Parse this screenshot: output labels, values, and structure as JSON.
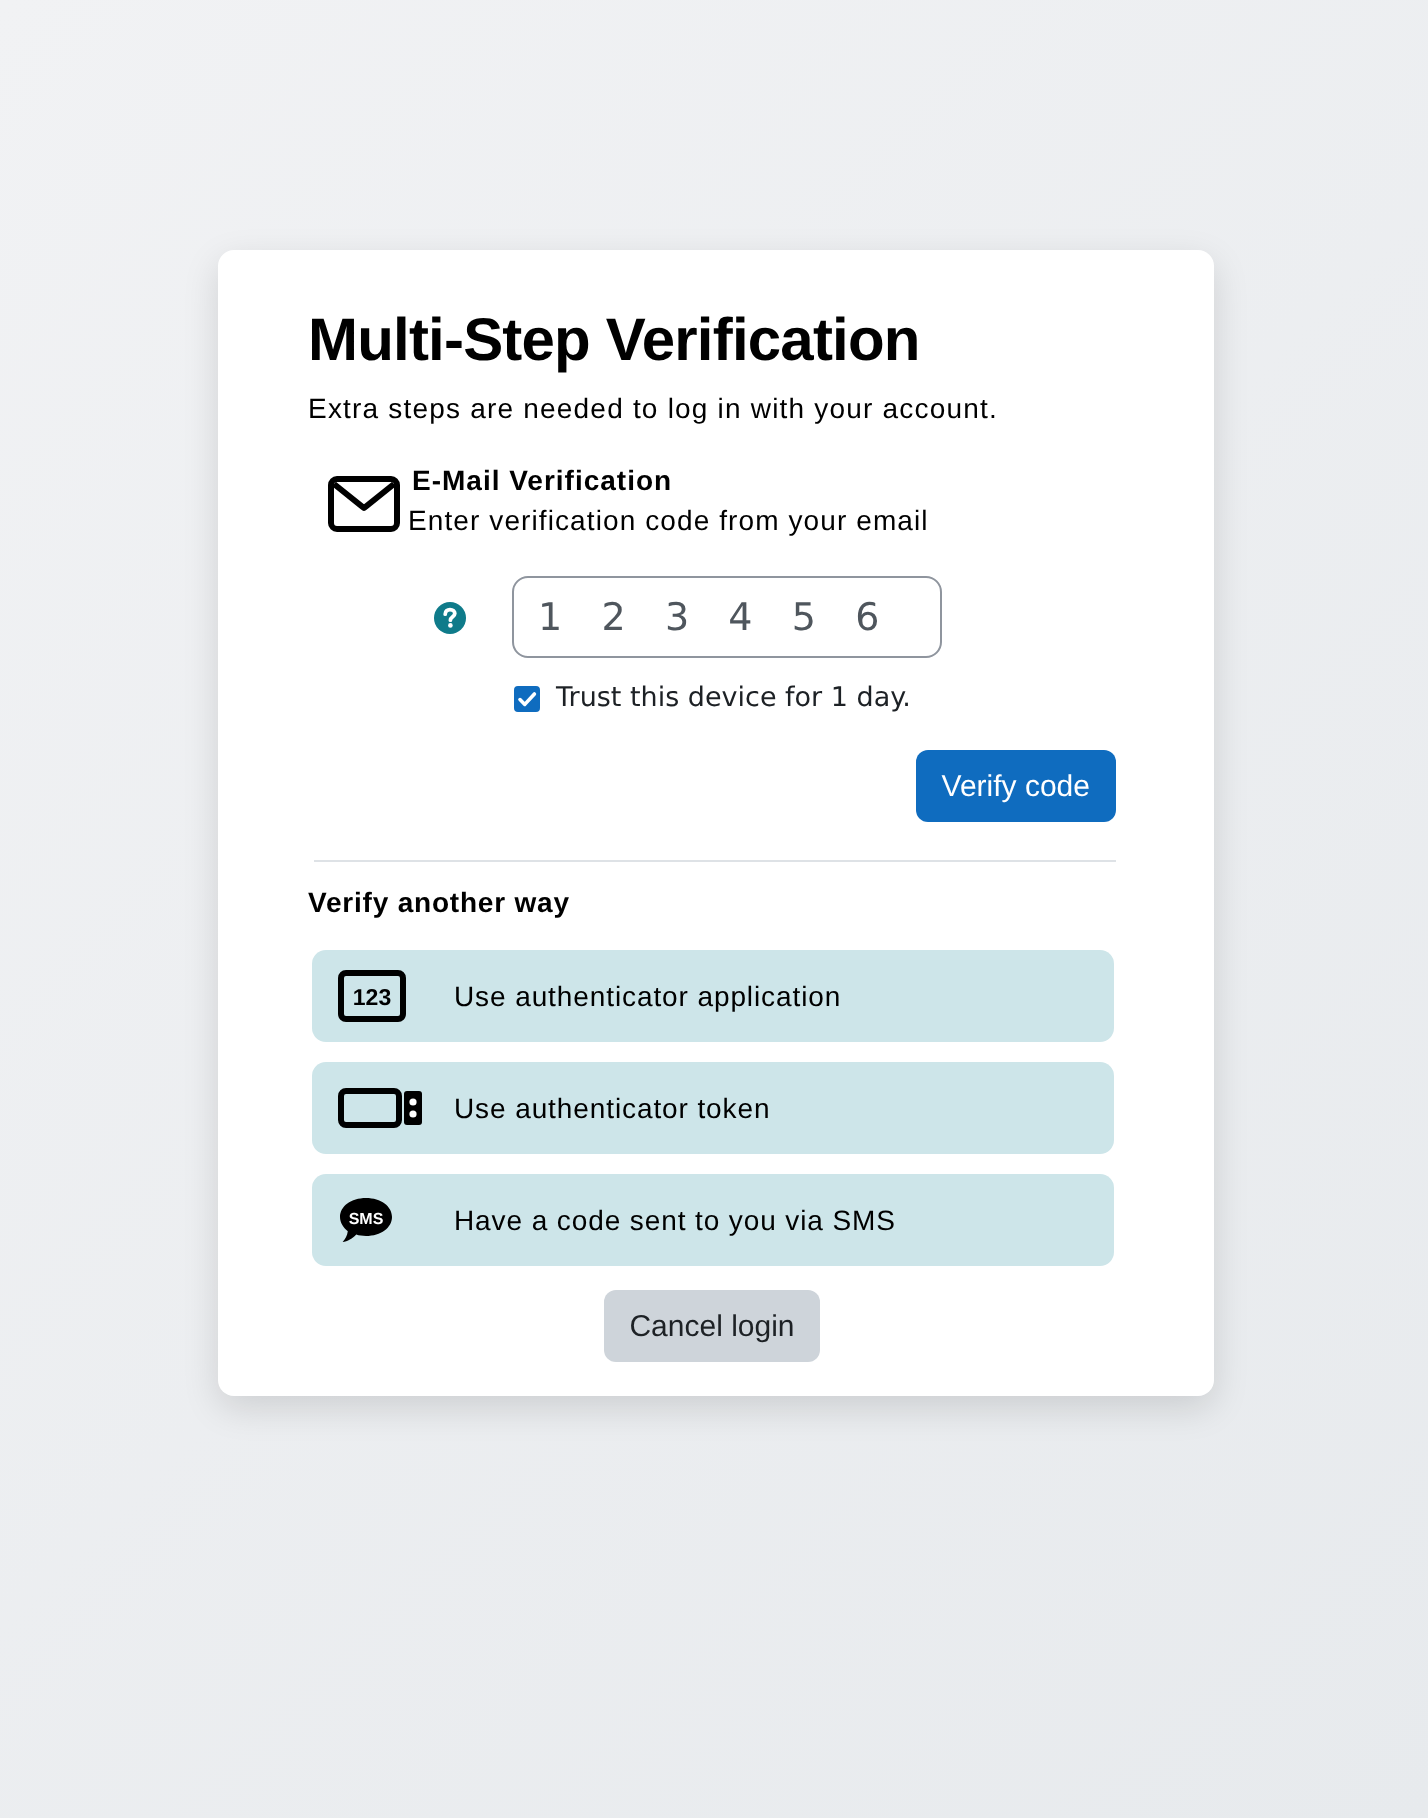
{
  "title": "Multi-Step Verification",
  "subtitle": "Extra steps are needed to log in with your account.",
  "factor": {
    "kind": "email",
    "title": "E-Mail Verification",
    "description": "Enter verification code from your email"
  },
  "code_field": {
    "placeholder": "1 2 3 4 5 6"
  },
  "trust_device": {
    "label": "Trust this device for 1 day.",
    "checked": true
  },
  "verify_button": "Verify code",
  "other_ways": {
    "heading": "Verify another way",
    "options": [
      {
        "kind": "app",
        "icon_text": "123",
        "label": "Use authenticator application"
      },
      {
        "kind": "token",
        "label": "Use authenticator token"
      },
      {
        "kind": "sms",
        "icon_text": "SMS",
        "label": "Have a code sent to you via SMS"
      }
    ]
  },
  "cancel_button": "Cancel login"
}
